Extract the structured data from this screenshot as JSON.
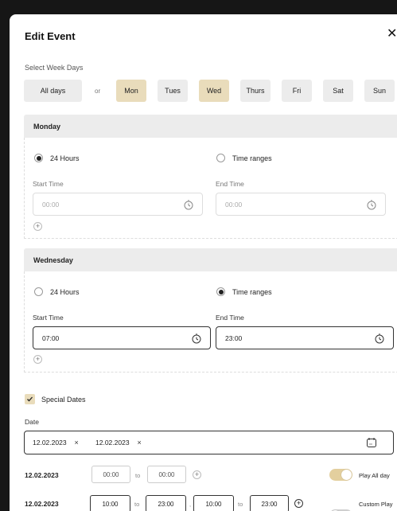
{
  "dialog": {
    "title": "Edit Event",
    "close_glyph": "✕"
  },
  "week_days": {
    "label": "Select Week Days",
    "all_days": "All days",
    "or": "or",
    "days": [
      {
        "label": "Mon",
        "selected": true
      },
      {
        "label": "Tues",
        "selected": false
      },
      {
        "label": "Wed",
        "selected": true
      },
      {
        "label": "Thurs",
        "selected": false
      },
      {
        "label": "Fri",
        "selected": false
      },
      {
        "label": "Sat",
        "selected": false
      },
      {
        "label": "Sun",
        "selected": false
      }
    ]
  },
  "monday": {
    "title": "Monday",
    "option_24h": "24 Hours",
    "option_ranges": "Time ranges",
    "selected": "24h",
    "start_label": "Start Time",
    "end_label": "End Time",
    "start_value": "00:00",
    "end_value": "00:00",
    "add_glyph": "+"
  },
  "wednesday": {
    "title": "Wednesday",
    "option_24h": "24 Hours",
    "option_ranges": "Time ranges",
    "selected": "ranges",
    "start_label": "Start Time",
    "end_label": "End Time",
    "start_value": "07:00",
    "end_value": "23:00",
    "add_glyph": "+"
  },
  "special_dates": {
    "label": "Special Dates",
    "checked": true,
    "date_label": "Date",
    "chips": [
      "12.02.2023",
      "12.02.2023"
    ],
    "remove_glyph": "×",
    "rows": [
      {
        "date": "12.02.2023",
        "ranges": [
          {
            "from": "00:00",
            "to": "00:00"
          }
        ],
        "to_label": "to",
        "toggle_label": "Play All day",
        "toggle_on": true
      },
      {
        "date": "12.02.2023",
        "ranges": [
          {
            "from": "10:00",
            "to": "23:00"
          },
          {
            "from": "10:00",
            "to": "23:00"
          }
        ],
        "to_label": "to",
        "separator": ",",
        "toggle_label": "Custom Play",
        "toggle_on": false
      }
    ]
  },
  "colors": {
    "accent": "#e9dcbb",
    "toggle_on": "#e3cf9e",
    "toggle_off": "#cfcfcf"
  },
  "icons": {
    "time": "stopwatch-icon",
    "calendar": "calendar-icon",
    "check": "check-icon"
  }
}
